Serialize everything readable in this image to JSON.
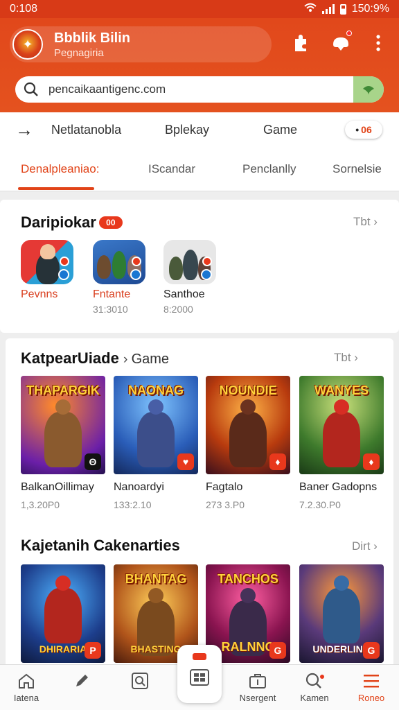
{
  "status": {
    "time": "0:108",
    "battery": "150:9%"
  },
  "header": {
    "title": "Bbblik Bilin",
    "subtitle": "Pegnagiria"
  },
  "search": {
    "value": "pencaikaantigenc.com"
  },
  "tabs_top": {
    "items": [
      "Netlatanobla",
      "Bplekay",
      "Game"
    ],
    "badge": {
      "prefix": "•",
      "value": "06"
    }
  },
  "tabs_sub": {
    "items": [
      "Denalpleaniao:",
      "IScandar",
      "Penclanlly",
      "Sornelsie"
    ],
    "active_index": 0
  },
  "featured": {
    "title": "Daripiokar",
    "badge": "00",
    "more": "Tbt",
    "apps": [
      {
        "label": "Pevnns",
        "count": ""
      },
      {
        "label": "Fntante",
        "count": "31:3010"
      },
      {
        "label": "Santhoe",
        "count": "8:2000"
      }
    ]
  },
  "games_section": {
    "title": "KatpearUiade",
    "crumb": "Game",
    "more": "Tbt",
    "items": [
      {
        "art_title": "THAPARGIK",
        "name": "BalkanOillimay",
        "count": "1,3.20P0",
        "corner": "Θ"
      },
      {
        "art_title": "NAONAG",
        "name": "Nanoardyi",
        "count": "133:2.10",
        "corner": "♥"
      },
      {
        "art_title": "NOUNDIE",
        "name": "Fagtalo",
        "count": "273 3.P0",
        "corner": "♦"
      },
      {
        "art_title": "WANYES",
        "name": "Baner Gadopns",
        "count": "7.2.30.P0",
        "corner": "♦"
      }
    ]
  },
  "second_section": {
    "title": "Kajetanih Cakenarties",
    "more": "Dirt",
    "items": [
      {
        "art_title": "",
        "bottom": "DHIRARIA",
        "corner": "P"
      },
      {
        "art_title": "BHANTAG",
        "bottom": "BHASTING",
        "corner": ""
      },
      {
        "art_title": "TANCHOS",
        "bottom": "RALNNO",
        "corner": "G"
      },
      {
        "art_title": "",
        "bottom": "UNDERLING",
        "corner": "G"
      }
    ]
  },
  "nav": [
    {
      "label": "Iatena",
      "icon": "home-icon"
    },
    {
      "label": "",
      "icon": "pencil-icon"
    },
    {
      "label": "",
      "icon": "search-box-icon"
    },
    {
      "label": "Nsergent",
      "icon": "briefcase-icon"
    },
    {
      "label": "Kamen",
      "icon": "search-icon"
    },
    {
      "label": "Roneo",
      "icon": "menu-icon"
    }
  ],
  "colors": {
    "brand": "#e14318",
    "header": "#e1481b"
  }
}
